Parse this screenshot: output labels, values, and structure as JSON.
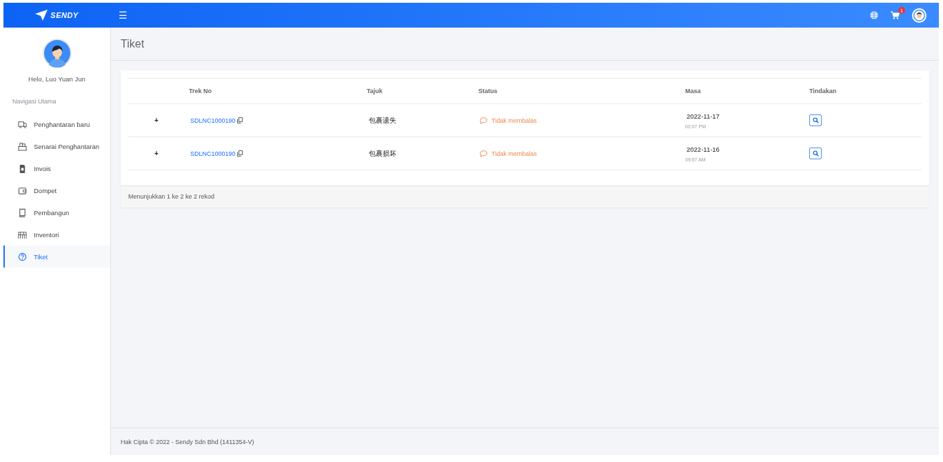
{
  "header": {
    "logo": "SENDY",
    "menu_toggle": "☰",
    "cart_badge": "1"
  },
  "sidebar": {
    "greeting": "Helo, Luo Yuan Jun",
    "section": "Navigasi Utama",
    "items": [
      {
        "label": "Penghantaran baru",
        "selected": false
      },
      {
        "label": "Senarai Penghantaran",
        "selected": false
      },
      {
        "label": "Invois",
        "selected": false
      },
      {
        "label": "Dompet",
        "selected": false
      },
      {
        "label": "Pembangun",
        "selected": false
      },
      {
        "label": "Inventori",
        "selected": false
      },
      {
        "label": "Tiket",
        "selected": true
      }
    ]
  },
  "page": {
    "title": "Tiket"
  },
  "table": {
    "columns": [
      "Trek No",
      "Tajuk",
      "Status",
      "Masa",
      "Tindakan"
    ],
    "rows": [
      {
        "expand": "+",
        "trek_no": "SDLNC1000190",
        "tajuk": "包裹遗失",
        "status": "Tidak membalas",
        "date": "2022-11-17",
        "time": "02:07 PM"
      },
      {
        "expand": "+",
        "trek_no": "SDLNC1000190",
        "tajuk": "包裹损坏",
        "status": "Tidak membalas",
        "date": "2022-11-16",
        "time": "09:57 AM"
      }
    ],
    "summary": "Menunjukkan 1 ke 2 ke 2 rekod"
  },
  "footer": "Hak Cipta © 2022 - Sendy Sdn Bhd (1411354-V)"
}
